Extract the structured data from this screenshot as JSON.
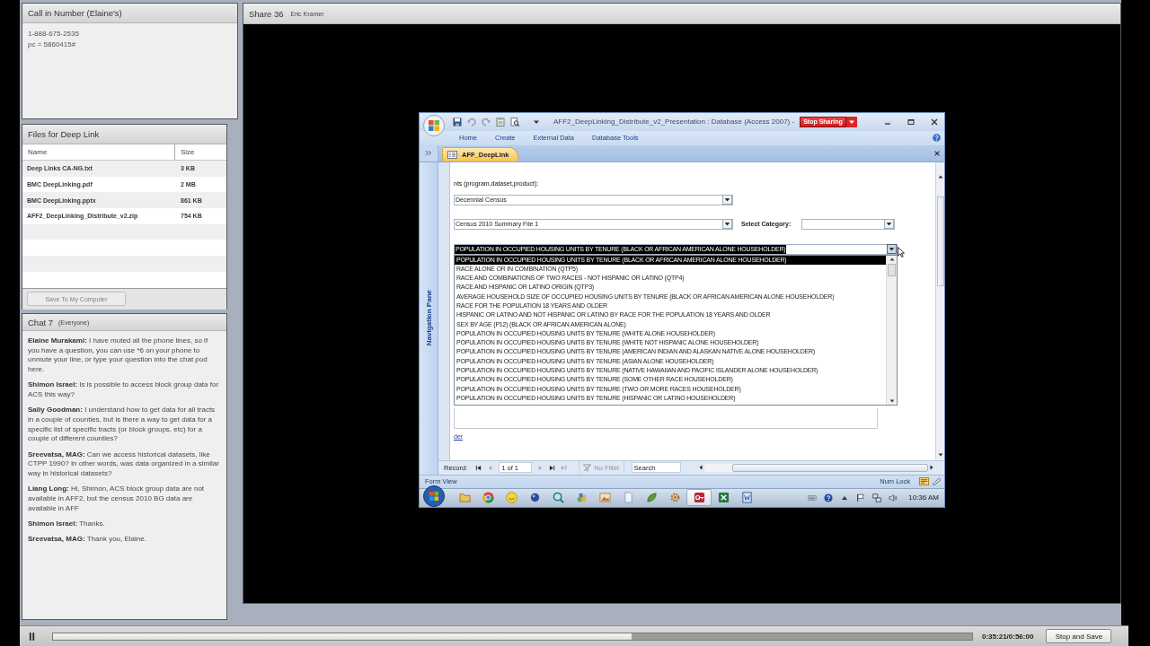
{
  "call_pod": {
    "title": "Call in Number (Elaine's)",
    "lines": [
      "1-888-675-2535",
      "pc = 5860415#"
    ]
  },
  "files_pod": {
    "title": "Files for Deep Link",
    "columns": [
      "Name",
      "Size"
    ],
    "rows": [
      {
        "name": "Deep Links CA-NG.txt",
        "size": "3 KB"
      },
      {
        "name": "BMC DeepLinking.pdf",
        "size": "2 MB"
      },
      {
        "name": "BMC DeepLinking.pptx",
        "size": "861 KB"
      },
      {
        "name": "AFF2_DeepLinking_Distribute_v2.zip",
        "size": "754 KB"
      }
    ],
    "save_button": {
      "label": "Save To My Computer",
      "disabled": true
    }
  },
  "chat_pod": {
    "title": "Chat 7",
    "audience": "(Everyone)",
    "messages": [
      {
        "sender": "Elaine Murakami:",
        "text": "I have muted all the phone lines, so if you have a question, you can use *6 on your phone to unmute your line, or type your question into the chat pod here."
      },
      {
        "sender": "Shimon Israel:",
        "text": "Is is possible to access block group data for ACS this way?"
      },
      {
        "sender": "Sally Goodman:",
        "text": "I understand how to get data for all tracts in a couple of counties, but is there a way to get data for a specific list of specific tracts (or block groups, etc) for a couple of different counties?"
      },
      {
        "sender": "Sreevatsa, MAG:",
        "text": "Can we access historical datasets, like CTPP 1990? In other words, was data organized in a similar way in historical datasets?"
      },
      {
        "sender": "Liang Long:",
        "text": "Hi, Shimon, ACS block group data are not available in AFF2, but the census 2010 BG data are available in AFF"
      },
      {
        "sender": "Shimon Israel:",
        "text": "Thanks."
      },
      {
        "sender": "Sreevatsa, MAG:",
        "text": "Thank you, Elaine."
      }
    ]
  },
  "share_pod": {
    "title": "Share 36",
    "presenter": "Eric Kramer",
    "app_window": {
      "title": "AFF2_DeepLinking_Distribute_v2_Presentation : Database (Access 2007) -",
      "stop_sharing_button": "Stop Sharing",
      "ribbon_tabs": [
        "Home",
        "Create",
        "External Data",
        "Database Tools"
      ],
      "document_tab": {
        "label": "AFF_DeepLink",
        "selected": true
      },
      "navigation_pane": "Navigation Pane",
      "form": {
        "prompt": "nts (program,dataset,product):",
        "program_combo": "Decennial Census",
        "dataset_combo": "Census 2010 Summary File 1",
        "category_label": "Select Category:",
        "table_combo": "POPULATION IN OCCUPIED HOUSING UNITS BY TENURE (BLACK OR AFRICAN AMERICAN ALONE HOUSEHOLDER)",
        "table_options": [
          {
            "label": "POPULATION IN OCCUPIED HOUSING UNITS BY TENURE (BLACK OR AFRICAN AMERICAN ALONE HOUSEHOLDER)",
            "selected": true
          },
          {
            "label": "RACE ALONE OR IN COMBINATION (QTP5)",
            "selected": false
          },
          {
            "label": "RACE AND COMBINATIONS OF TWO RACES - NOT HISPANIC OR LATINO (QTP4)",
            "selected": false
          },
          {
            "label": "RACE AND HISPANIC OR LATINO ORIGIN (QTP3)",
            "selected": false
          },
          {
            "label": "AVERAGE HOUSEHOLD SIZE OF OCCUPIED HOUSING UNITS BY TENURE (BLACK OR AFRICAN AMERICAN ALONE HOUSEHOLDER)",
            "selected": false
          },
          {
            "label": "RACE FOR THE POPULATION 18 YEARS AND OLDER",
            "selected": false
          },
          {
            "label": "HISPANIC OR LATINO AND NOT HISPANIC OR LATINO BY RACE FOR THE POPULATION 18 YEARS AND OLDER",
            "selected": false
          },
          {
            "label": "SEX BY AGE (P12) (BLACK OR AFRICAN AMERICAN ALONE)",
            "selected": false
          },
          {
            "label": "POPULATION IN OCCUPIED HOUSING UNITS BY TENURE (WHITE ALONE HOUSEHOLDER)",
            "selected": false
          },
          {
            "label": "POPULATION IN OCCUPIED HOUSING UNITS BY TENURE (WHITE NOT HISPANIC ALONE HOUSEHOLDER)",
            "selected": false
          },
          {
            "label": "POPULATION IN OCCUPIED HOUSING UNITS BY TENURE (AMERICAN INDIAN AND ALASKAN NATIVE ALONE HOUSEHOLDER)",
            "selected": false
          },
          {
            "label": "POPULATION IN OCCUPIED HOUSING UNITS BY TENURE (ASIAN ALONE HOUSEHOLDER)",
            "selected": false
          },
          {
            "label": "POPULATION IN OCCUPIED HOUSING UNITS BY TENURE (NATIVE HAWAIIAN AND PACIFIC ISLANDER ALONE HOUSEHOLDER)",
            "selected": false
          },
          {
            "label": "POPULATION IN OCCUPIED HOUSING UNITS BY TENURE (SOME OTHER RACE HOUSEHOLDER)",
            "selected": false
          },
          {
            "label": "POPULATION IN OCCUPIED HOUSING UNITS BY TENURE (TWO OR MORE RACES HOUSEHOLDER)",
            "selected": false
          },
          {
            "label": "POPULATION IN OCCUPIED HOUSING UNITS BY TENURE (HISPANIC OR LATINO HOUSEHOLDER)",
            "selected": false
          }
        ],
        "link": "der"
      },
      "record_nav": {
        "label": "Record:",
        "position": "1 of 1",
        "filter": {
          "label": "No Filter",
          "disabled": true
        },
        "search_placeholder": "Search"
      },
      "status_bar": {
        "view": "Form View",
        "keys": "Num Lock"
      },
      "taskbar": {
        "clock": "10:36 AM"
      }
    }
  },
  "playback": {
    "level": 0.63,
    "time": "0:35:21/0:56:00",
    "stop_button": "Stop and Save"
  }
}
